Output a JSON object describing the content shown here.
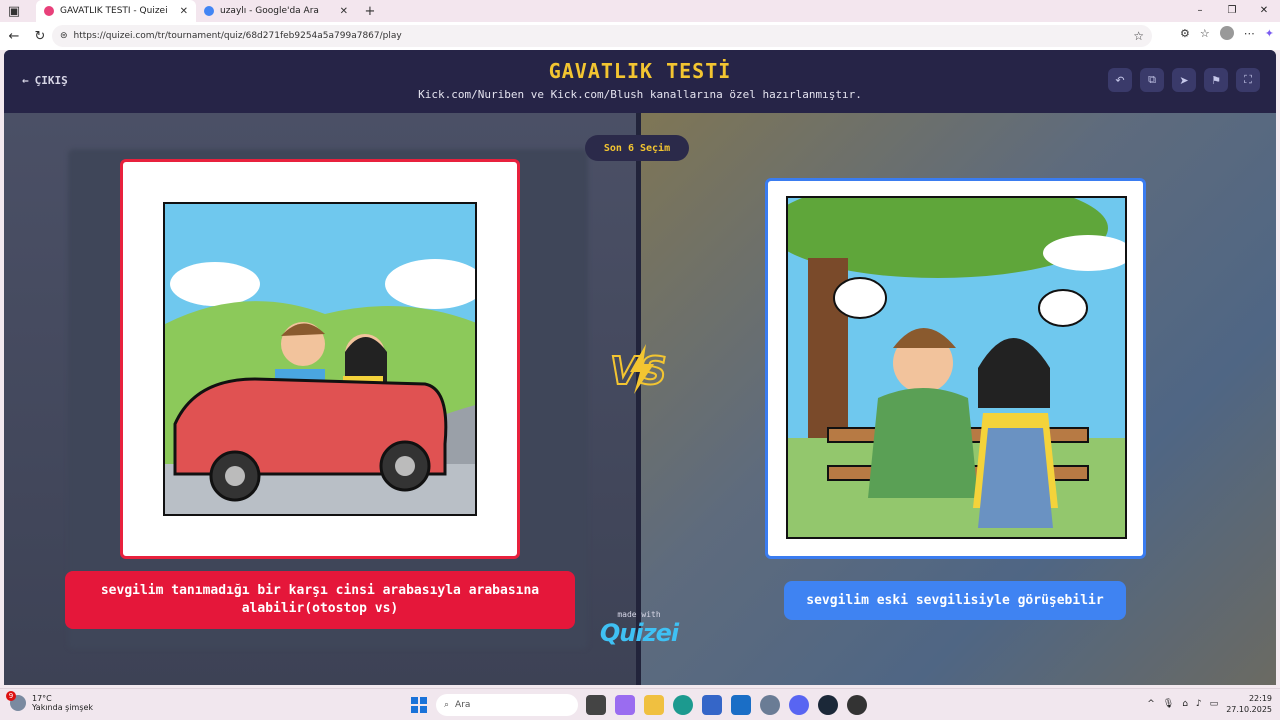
{
  "browser": {
    "tabs": [
      {
        "title": "GAVATLIK TESTİ - Quizei",
        "active": true
      },
      {
        "title": "uzaylı - Google'da Ara",
        "active": false
      }
    ],
    "new_tab": "+",
    "url": "https://quizei.com/tr/tournament/quiz/68d271feb9254a5a799a7867/play",
    "window_controls": [
      "–",
      "❐",
      "✕"
    ]
  },
  "app": {
    "exit_label": "ÇIKIŞ",
    "title": "GAVATLIK TESTİ",
    "subtitle": "Kick.com/Nuriben ve Kick.com/Blush kanallarına özel hazırlanmıştır.",
    "round_label": "Son 6 Seçim",
    "actions": [
      "undo-icon",
      "share-icon",
      "send-icon",
      "flag-icon",
      "fullscreen-icon"
    ],
    "left_option": "sevgilim tanımadığı bir karşı cinsi arabasıyla arabasına alabilir(otostop vs)",
    "right_option": "sevgilim eski sevgilisiyle görüşebilir",
    "made_with": "made with",
    "brand": "Quizei",
    "colors": {
      "accent": "#f3c531",
      "left": "#e5173a",
      "right": "#3f83f2",
      "header": "#262447"
    }
  },
  "taskbar": {
    "weather_temp": "17°C",
    "weather_desc": "Yakında şimşek",
    "weather_badge": "9",
    "search_placeholder": "Ara",
    "time": "22:19",
    "date": "27.10.2025"
  }
}
